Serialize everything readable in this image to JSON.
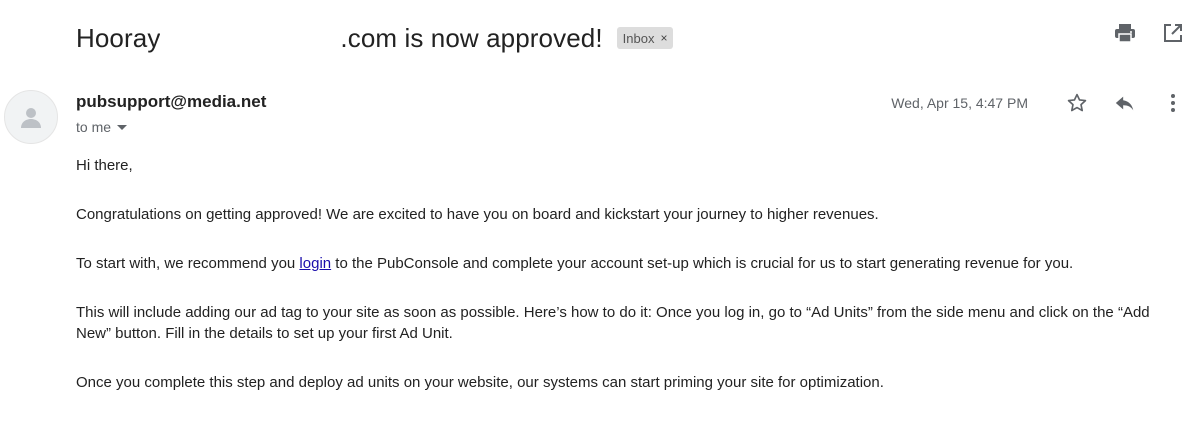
{
  "subject": {
    "prefix": "Hooray",
    "suffix": ".com is now approved!",
    "label": "Inbox",
    "label_close": "×"
  },
  "message": {
    "sender": "pubsupport@media.net",
    "recipient": "to me",
    "timestamp": "Wed, Apr 15, 4:47 PM"
  },
  "body": {
    "p1": "Hi there,",
    "p2": "Congratulations on getting approved! We are excited to have you on board and kickstart your journey to higher revenues.",
    "p3_before": "To start with, we recommend you ",
    "p3_link": "login",
    "p3_after": " to the PubConsole and complete your account set-up which is crucial for us to start generating revenue for you.",
    "p4": "This will include adding our ad tag to your site as soon as possible. Here’s how to do it: Once you log in, go to “Ad Units” from the side menu and click on the “Add New” button. Fill in the details to set up your first Ad Unit.",
    "p5": "Once you complete this step and deploy ad units on your website, our systems can start priming your site for optimization."
  },
  "icons": [
    "print-icon",
    "open-in-new-window-icon",
    "star-icon",
    "reply-icon",
    "more-vert-icon",
    "person-icon",
    "dropdown-caret-icon"
  ]
}
